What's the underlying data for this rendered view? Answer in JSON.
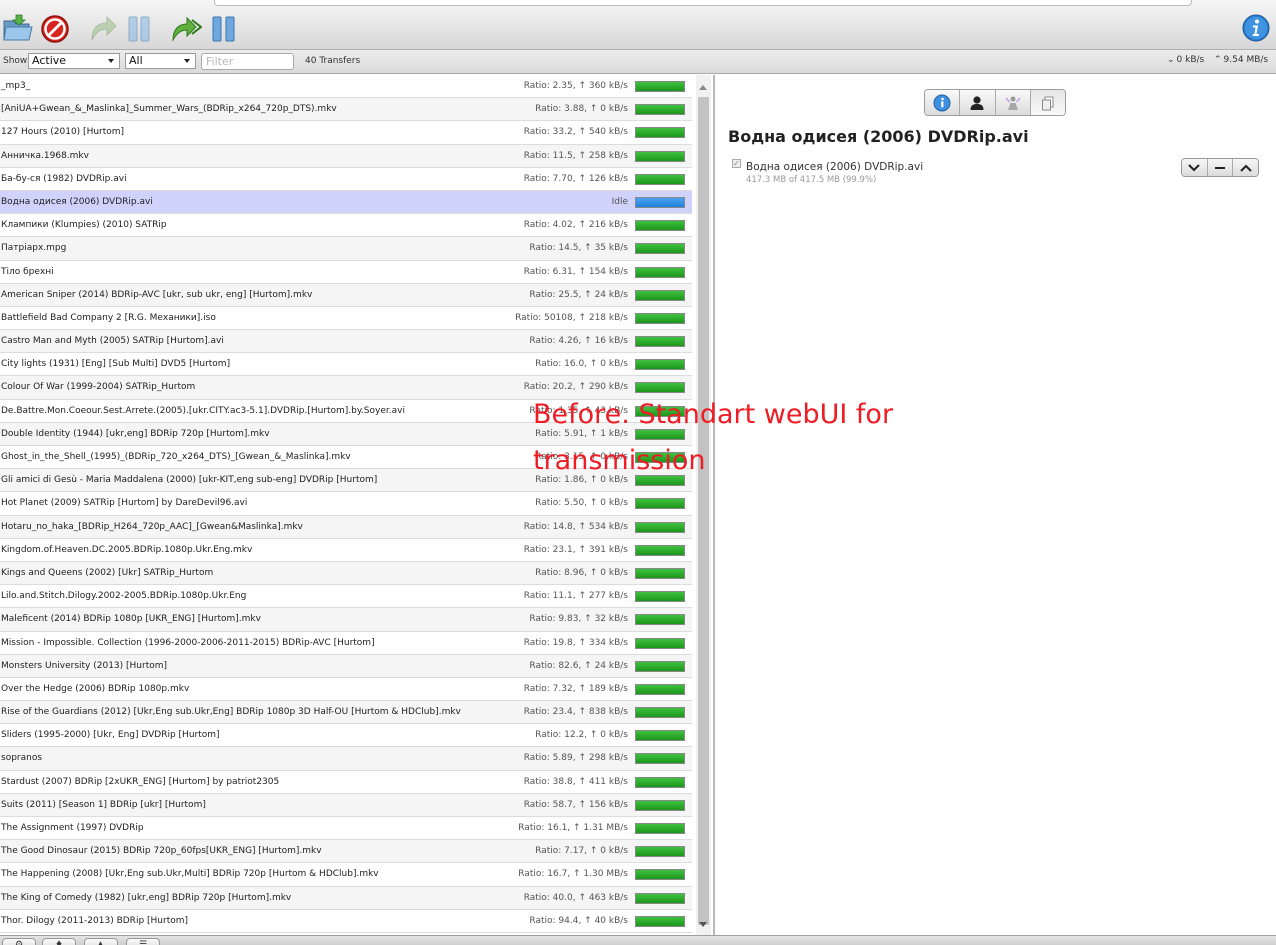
{
  "toolbar": {
    "buttons": [
      {
        "name": "open-torrent",
        "icon": "folder-open-icon"
      },
      {
        "name": "remove-torrent",
        "icon": "stop-sign-icon"
      },
      {
        "name": "resume",
        "icon": "resume-arrow-icon"
      },
      {
        "name": "pause",
        "icon": "pause-icon"
      },
      {
        "name": "resume-all",
        "icon": "resume-all-arrow-icon"
      },
      {
        "name": "pause-all",
        "icon": "pause-all-icon"
      }
    ],
    "inspector_button_icon": "info-icon"
  },
  "filterbar": {
    "show_label": "Show",
    "state_filter": "Active",
    "tracker_filter": "All",
    "filter_placeholder": "Filter",
    "transfers": "40 Transfers",
    "download_speed": "0 kB/s",
    "upload_speed": "9.54 MB/s"
  },
  "torrents": [
    {
      "name": "_mp3_",
      "status": "Ratio: 2.35, ↑ 360 kB/s"
    },
    {
      "name": "[AniUA+Gwean_&_Maslinka]_Summer_Wars_(BDRip_x264_720p_DTS).mkv",
      "status": "Ratio: 3.88, ↑ 0 kB/s"
    },
    {
      "name": "127 Hours (2010) [Hurtom]",
      "status": "Ratio: 33.2, ↑ 540 kB/s"
    },
    {
      "name": "Анничка.1968.mkv",
      "status": "Ratio: 11.5, ↑ 258 kB/s"
    },
    {
      "name": "Ба-бу-ся (1982) DVDRip.avi",
      "status": "Ratio: 7.70, ↑ 126 kB/s"
    },
    {
      "name": "Водна одисея (2006) DVDRip.avi",
      "status": "Idle"
    },
    {
      "name": "Клампики (Klumpies) (2010) SATRip",
      "status": "Ratio: 4.02, ↑ 216 kB/s"
    },
    {
      "name": "Патріарх.mpg",
      "status": "Ratio: 14.5, ↑ 35 kB/s"
    },
    {
      "name": "Тіло брехні",
      "status": "Ratio: 6.31, ↑ 154 kB/s"
    },
    {
      "name": "American Sniper (2014) BDRip-AVC [ukr, sub ukr, eng] [Hurtom].mkv",
      "status": "Ratio: 25.5, ↑ 24 kB/s"
    },
    {
      "name": "Battlefield Bad Company 2 [R.G. Механики].iso",
      "status": "Ratio: 50108, ↑ 218 kB/s"
    },
    {
      "name": "Castro Man and Myth (2005) SATRip [Hurtom].avi",
      "status": "Ratio: 4.26, ↑ 16 kB/s"
    },
    {
      "name": "City lights (1931) [Eng] [Sub Multi] DVD5 [Hurtom]",
      "status": "Ratio: 16.0, ↑ 0 kB/s"
    },
    {
      "name": "Colour Of War (1999-2004) SATRip_Hurtom",
      "status": "Ratio: 20.2, ↑ 290 kB/s"
    },
    {
      "name": "De.Battre.Mon.Coeour.Sest.Arrete.(2005).[ukr.CITY.ac3-5.1].DVDRip.[Hurtom].by.Soyer.avi",
      "status": "Ratio: 1.35, ↑ 43 kB/s"
    },
    {
      "name": "Double Identity (1944) [ukr,eng] BDRip 720p [Hurtom].mkv",
      "status": "Ratio: 5.91, ↑ 1 kB/s"
    },
    {
      "name": "Ghost_in_the_Shell_(1995)_(BDRip_720_x264_DTS)_[Gwean_&_Maslinka].mkv",
      "status": "Ratio: 3.15, ↑ 0 kB/s"
    },
    {
      "name": "Gli amici di Gesù - Maria Maddalena (2000) [ukr-KIT,eng sub-eng] DVDRip [Hurtom]",
      "status": "Ratio: 1.86, ↑ 0 kB/s"
    },
    {
      "name": "Hot Planet (2009) SATRip [Hurtom] by DareDevil96.avi",
      "status": "Ratio: 5.50, ↑ 0 kB/s"
    },
    {
      "name": "Hotaru_no_haka_[BDRip_H264_720p_AAC]_[Gwean&Maslinka].mkv",
      "status": "Ratio: 14.8, ↑ 534 kB/s"
    },
    {
      "name": "Kingdom.of.Heaven.DC.2005.BDRip.1080p.Ukr.Eng.mkv",
      "status": "Ratio: 23.1, ↑ 391 kB/s"
    },
    {
      "name": "Kings and Queens (2002) [Ukr] SATRip_Hurtom",
      "status": "Ratio: 8.96, ↑ 0 kB/s"
    },
    {
      "name": "Lilo.and.Stitch.Dilogy.2002-2005.BDRip.1080p.Ukr.Eng",
      "status": "Ratio: 11.1, ↑ 277 kB/s"
    },
    {
      "name": "Maleficent (2014) BDRip 1080p [UKR_ENG] [Hurtom].mkv",
      "status": "Ratio: 9.83, ↑ 32 kB/s"
    },
    {
      "name": "Mission - Impossible. Collection (1996-2000-2006-2011-2015) BDRip-AVC [Hurtom]",
      "status": "Ratio: 19.8, ↑ 334 kB/s"
    },
    {
      "name": "Monsters University (2013) [Hurtom]",
      "status": "Ratio: 82.6, ↑ 24 kB/s"
    },
    {
      "name": "Over the Hedge (2006) BDRip 1080p.mkv",
      "status": "Ratio: 7.32, ↑ 189 kB/s"
    },
    {
      "name": "Rise of the Guardians (2012) [Ukr,Eng sub.Ukr,Eng] BDRip 1080p 3D Half-OU [Hurtom & HDClub].mkv",
      "status": "Ratio: 23.4, ↑ 838 kB/s"
    },
    {
      "name": "Sliders (1995-2000) [Ukr, Eng] DVDRip [Hurtom]",
      "status": "Ratio: 12.2, ↑ 0 kB/s"
    },
    {
      "name": "sopranos",
      "status": "Ratio: 5.89, ↑ 298 kB/s"
    },
    {
      "name": "Stardust (2007) BDRip [2xUKR_ENG] [Hurtom] by patriot2305",
      "status": "Ratio: 38.8, ↑ 411 kB/s"
    },
    {
      "name": "Suits (2011) [Season 1] BDRip [ukr] [Hurtom]",
      "status": "Ratio: 58.7, ↑ 156 kB/s"
    },
    {
      "name": "The Assignment (1997) DVDRip",
      "status": "Ratio: 16.1, ↑ 1.31 MB/s"
    },
    {
      "name": "The Good Dinosaur (2015) BDRip 720p_60fps[UKR_ENG] [Hurtom].mkv",
      "status": "Ratio: 7.17, ↑ 0 kB/s"
    },
    {
      "name": "The Happening (2008) [Ukr,Eng sub.Ukr,Multi] BDRip 720p [Hurtom & HDClub].mkv",
      "status": "Ratio: 16.7, ↑ 1.30 MB/s"
    },
    {
      "name": "The King of Comedy (1982) [ukr,eng] BDRip 720p [Hurtom].mkv",
      "status": "Ratio: 40.0, ↑ 463 kB/s"
    },
    {
      "name": "Thor. Dilogy (2011-2013) BDRip [Hurtom]",
      "status": "Ratio: 94.4, ↑ 40 kB/s"
    }
  ],
  "inspector": {
    "tabs": [
      "info-icon",
      "peers-icon",
      "trackers-icon",
      "files-icon"
    ],
    "title": "Водна одисея (2006) DVDRip.avi",
    "file": {
      "name": "Водна одисея (2006) DVDRip.avi",
      "progress": "417.3 MB of 417.5 MB (99.9%)",
      "checked": true
    },
    "priority_icons": [
      "chevron-down-icon",
      "minus-icon",
      "chevron-up-icon"
    ]
  },
  "annotation": "Before. Standart webUI for transmission",
  "colors": {
    "selected_row": "#cfd2fa",
    "bar_green": "#21a121",
    "bar_blue": "#2080d8",
    "annotation_red": "#ee1c24"
  }
}
